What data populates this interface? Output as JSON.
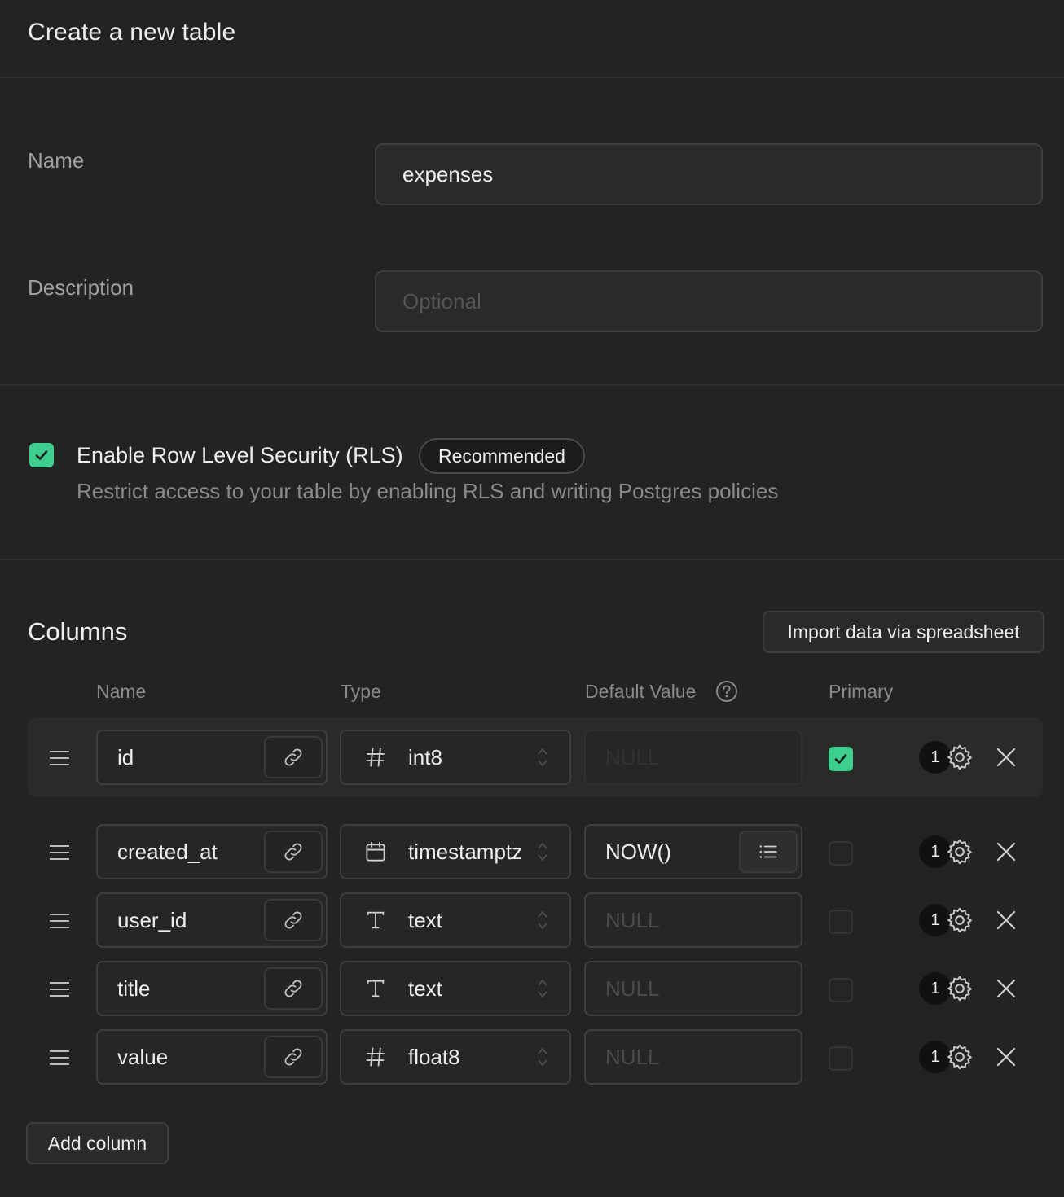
{
  "header": {
    "title": "Create a new table"
  },
  "form": {
    "name_label": "Name",
    "name_value": "expenses",
    "description_label": "Description",
    "description_placeholder": "Optional"
  },
  "rls": {
    "checked": true,
    "title": "Enable Row Level Security (RLS)",
    "badge": "Recommended",
    "description": "Restrict access to your table by enabling RLS and writing Postgres policies"
  },
  "columns": {
    "title": "Columns",
    "import_button": "Import data via spreadsheet",
    "headers": {
      "name": "Name",
      "type": "Type",
      "default": "Default Value",
      "primary": "Primary"
    },
    "rows": [
      {
        "name": "id",
        "type_icon": "hash-icon",
        "type": "int8",
        "default": "",
        "default_placeholder": "NULL",
        "primary": true,
        "count": "1"
      },
      {
        "name": "created_at",
        "type_icon": "calendar-icon",
        "type": "timestamptz",
        "default": "NOW()",
        "default_placeholder": "NULL",
        "primary": false,
        "count": "1"
      },
      {
        "name": "user_id",
        "type_icon": "text-icon",
        "type": "text",
        "default": "",
        "default_placeholder": "NULL",
        "primary": false,
        "count": "1"
      },
      {
        "name": "title",
        "type_icon": "text-icon",
        "type": "text",
        "default": "",
        "default_placeholder": "NULL",
        "primary": false,
        "count": "1"
      },
      {
        "name": "value",
        "type_icon": "hash-icon",
        "type": "float8",
        "default": "",
        "default_placeholder": "NULL",
        "primary": false,
        "count": "1"
      }
    ],
    "add_button": "Add column"
  },
  "colors": {
    "accent": "#3ecf8e",
    "background": "#232323",
    "border": "#3e3e3e"
  }
}
